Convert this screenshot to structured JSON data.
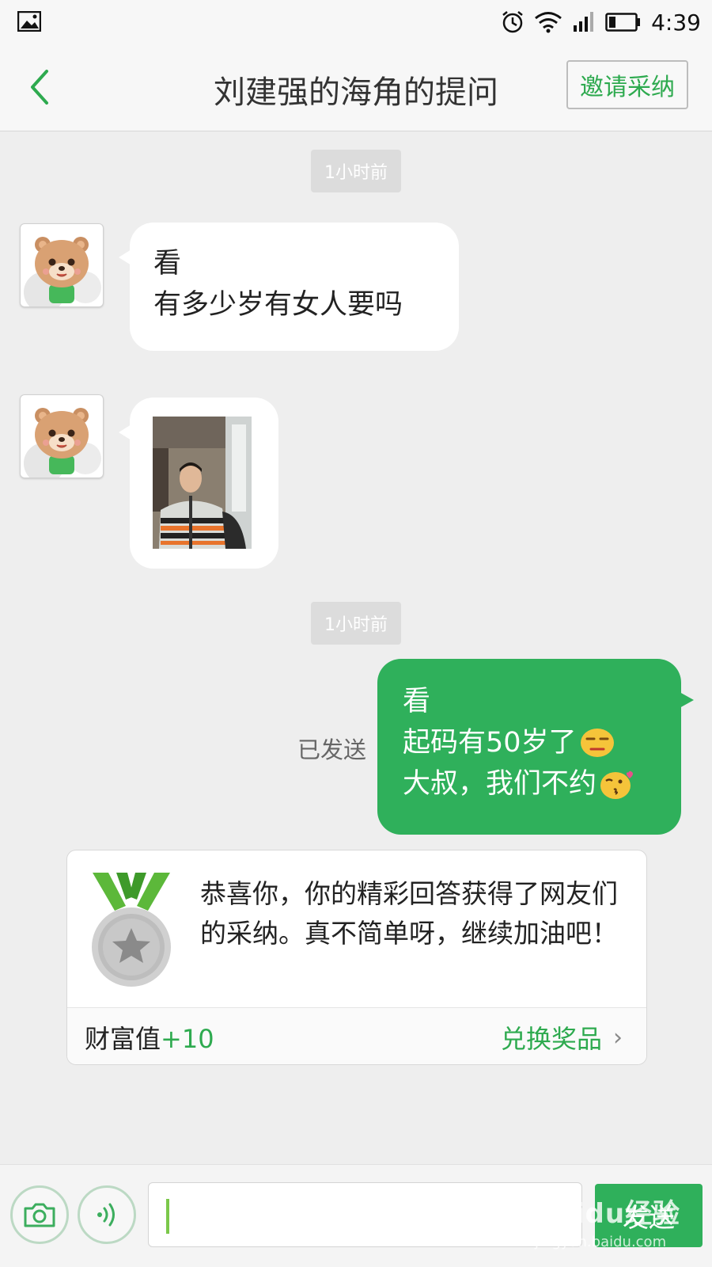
{
  "status_bar": {
    "time": "4:39",
    "icons": [
      "image-icon",
      "alarm-icon",
      "wifi-icon",
      "signal-icon",
      "battery-icon"
    ]
  },
  "header": {
    "title": "刘建强的海角的提问",
    "invite_label": "邀请采纳"
  },
  "messages": [
    {
      "type": "timestamp",
      "text": "1小时前"
    },
    {
      "type": "incoming",
      "lines": [
        "看",
        "有多少岁有女人要吗"
      ]
    },
    {
      "type": "incoming-photo"
    },
    {
      "type": "timestamp",
      "text": "1小时前"
    },
    {
      "type": "outgoing",
      "lines": [
        "看",
        "起码有50岁了",
        "大叔，我们不约"
      ],
      "status": "已发送"
    }
  ],
  "award": {
    "message": "恭喜你，你的精彩回答获得了网友们的采纳。真不简单呀，继续加油吧！",
    "wealth_label": "财富值",
    "wealth_value": "+10",
    "redeem_label": "兑换奖品"
  },
  "input_bar": {
    "value": "",
    "send_label": "发送"
  },
  "watermark": {
    "logo": "Baidu经验",
    "sub": "jingyan.baidu.com"
  },
  "colors": {
    "accent": "#2fb05b",
    "header_bg": "#f7f7f7",
    "chat_bg": "#eeeeee"
  }
}
